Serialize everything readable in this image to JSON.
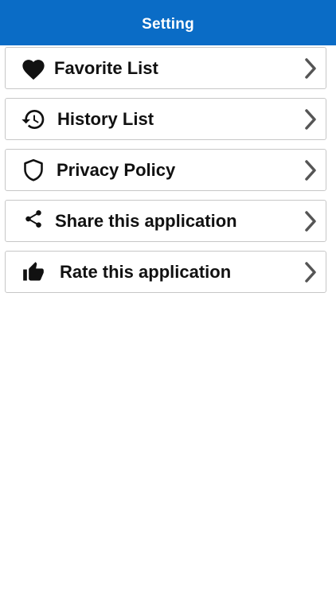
{
  "colors": {
    "header_bg": "#0a6cc6",
    "header_text": "#ffffff",
    "item_border": "#c7c7c7",
    "chevron": "#555555",
    "text": "#111111"
  },
  "header": {
    "title": "Setting"
  },
  "menu": {
    "items": [
      {
        "label": "Favorite List",
        "icon": "heart-icon"
      },
      {
        "label": "History List",
        "icon": "history-icon"
      },
      {
        "label": "Privacy Policy",
        "icon": "shield-icon"
      },
      {
        "label": "Share this application",
        "icon": "share-icon"
      },
      {
        "label": "Rate this application",
        "icon": "thumbs-up-icon"
      }
    ]
  }
}
